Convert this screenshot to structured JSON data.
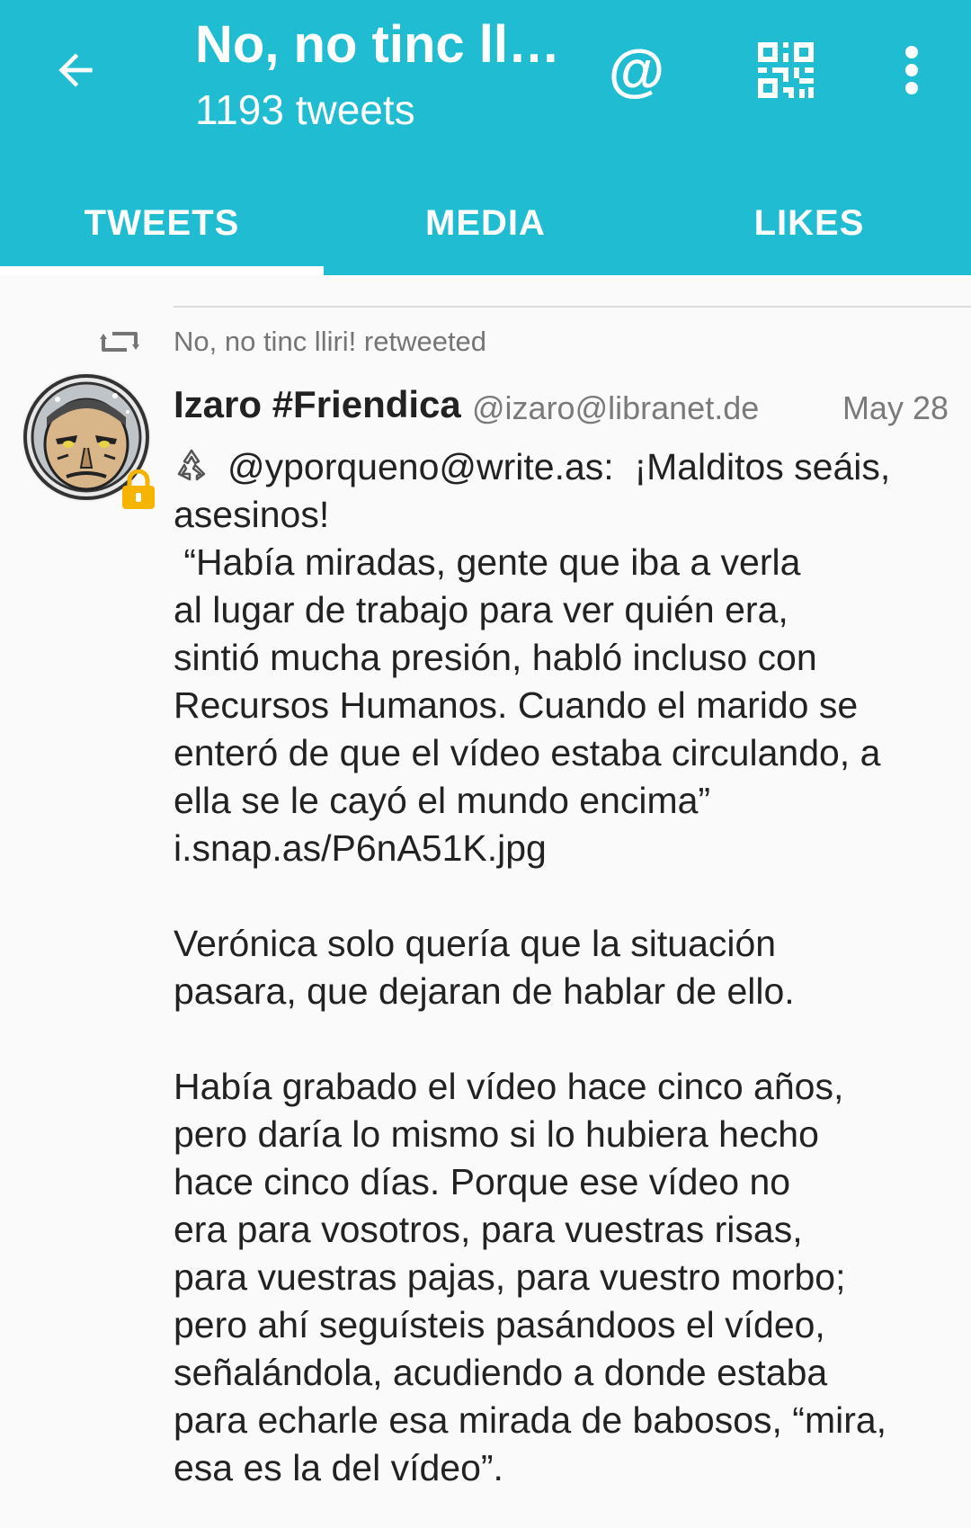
{
  "header": {
    "title": "No, no tinc ll…",
    "subtitle": "1193 tweets",
    "at_icon": "@",
    "background_color": "#1fbcd2"
  },
  "icons": {
    "back": "arrow-left-icon",
    "mention": "at-icon",
    "qr": "qr-code-icon",
    "more": "more-vert-icon",
    "retweet": "retweet-icon",
    "lock": "lock-icon",
    "recycle": "recycle-icon"
  },
  "tabs": [
    {
      "label": "TWEETS",
      "active": true
    },
    {
      "label": "MEDIA",
      "active": false
    },
    {
      "label": "LIKES",
      "active": false
    }
  ],
  "tweet": {
    "retweeted_by": "No, no tinc lliri! retweeted",
    "author_name": "Izaro #Friendica",
    "author_handle": "@izaro@libranet.de",
    "date": "May 28",
    "text": "@yporqueno@write.as:  ¡Malditos seáis, asesinos!\n “Había miradas, gente que iba a verla\nal lugar de trabajo para ver quién era,\nsintió mucha presión, habló incluso con\nRecursos Humanos. Cuando el marido se\nenteró de que el vídeo estaba circulando, a\nella se le cayó el mundo encima”\ni.snap.as/P6nA51K.jpg\n\nVerónica solo quería que la situación\npasara, que dejaran de hablar de ello.\n\nHabía grabado el vídeo hace cinco años,\npero daría lo mismo si lo hubiera hecho\nhace cinco días. Porque ese vídeo no\nera para vosotros, para vuestras risas,\npara vuestras pajas, para vuestro morbo;\npero ahí seguísteis pasándoos el vídeo,\nseñalándola, acudiendo a donde estaba\npara echarle esa mirada de babosos, “mira,\nesa es la del vídeo”."
  }
}
